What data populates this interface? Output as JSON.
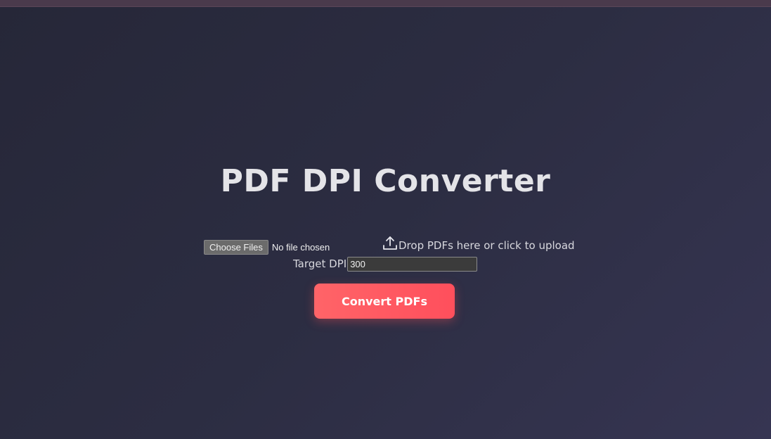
{
  "app": {
    "title": "PDF DPI Converter"
  },
  "file_input": {
    "button_label": "Choose Files",
    "status": "No file chosen"
  },
  "dropzone": {
    "icon": "upload-icon",
    "text": "Drop PDFs here or click to upload"
  },
  "dpi": {
    "label": "Target DPI",
    "value": "300"
  },
  "convert": {
    "label": "Convert PDFs"
  },
  "colors": {
    "accent": "#ff5a62",
    "background": "#2c2d42",
    "title": "#e4e4e8"
  }
}
